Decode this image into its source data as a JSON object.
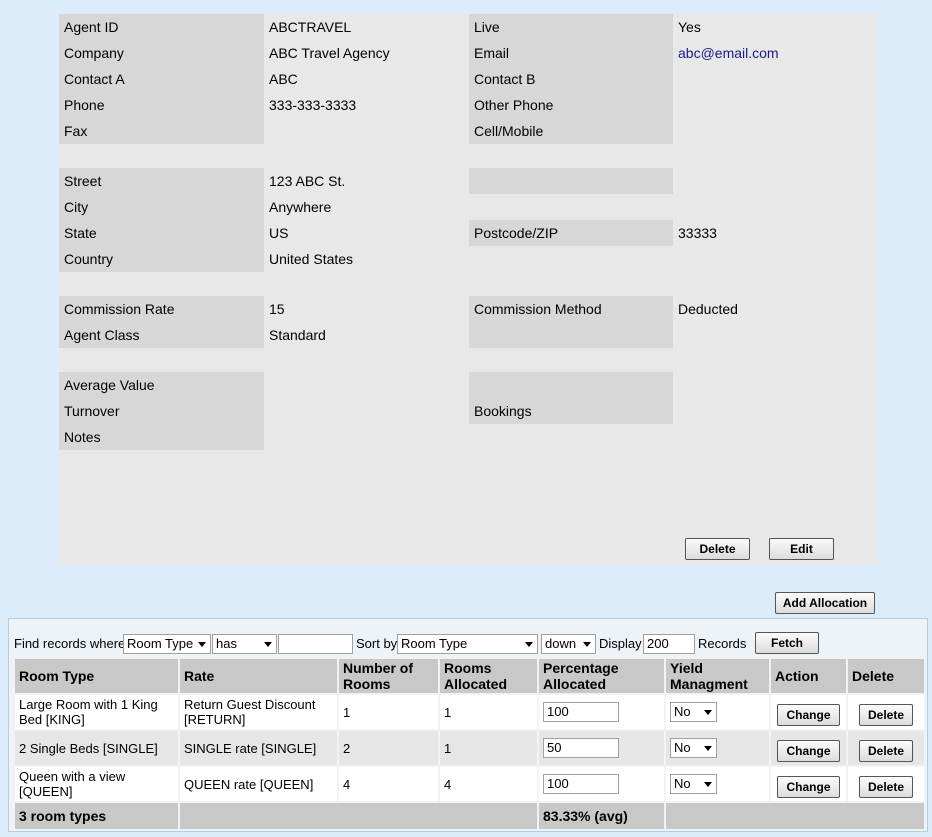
{
  "agent": {
    "fields": {
      "agent_id_label": "Agent ID",
      "agent_id": "ABCTRAVEL",
      "live_label": "Live",
      "live": "Yes",
      "company_label": "Company",
      "company": "ABC Travel Agency",
      "email_label": "Email",
      "email": "abc@email.com",
      "contact_a_label": "Contact A",
      "contact_a": "ABC",
      "contact_b_label": "Contact B",
      "contact_b": "",
      "phone_label": "Phone",
      "phone": "333-333-3333",
      "other_phone_label": "Other Phone",
      "other_phone": "",
      "fax_label": "Fax",
      "fax": "",
      "cell_label": "Cell/Mobile",
      "cell": "",
      "street_label": "Street",
      "street": "123 ABC St.",
      "city_label": "City",
      "city": "Anywhere",
      "state_label": "State",
      "state": "US",
      "postcode_label": "Postcode/ZIP",
      "postcode": "33333",
      "country_label": "Country",
      "country": "United States",
      "commission_rate_label": "Commission Rate",
      "commission_rate": "15",
      "commission_method_label": "Commission Method",
      "commission_method": "Deducted",
      "agent_class_label": "Agent Class",
      "agent_class": "Standard",
      "average_value_label": "Average Value",
      "turnover_label": "Turnover",
      "bookings_label": "Bookings",
      "notes_label": "Notes"
    },
    "buttons": {
      "delete": "Delete",
      "edit": "Edit"
    }
  },
  "allocations": {
    "add_button": "Add Allocation",
    "filter": {
      "find_label": "Find records where",
      "field": "Room Type",
      "operator": "has",
      "value": "",
      "sort_label": "Sort by",
      "sort_field": "Room Type",
      "direction": "down",
      "display_label": "Display",
      "display_count": "200",
      "records_label": "Records",
      "fetch_button": "Fetch"
    },
    "columns": {
      "room_type": "Room Type",
      "rate": "Rate",
      "num_rooms": "Number of Rooms",
      "rooms_allocated": "Rooms Allocated",
      "pct_allocated": "Percentage Allocated",
      "yield": "Yield Managment",
      "action": "Action",
      "delete": "Delete"
    },
    "rows": [
      {
        "room_type": "Large Room with 1 King Bed [KING]",
        "rate": "Return Guest Discount [RETURN]",
        "num_rooms": "1",
        "rooms_allocated": "1",
        "pct": "100",
        "yield": "No",
        "change": "Change",
        "delete": "Delete"
      },
      {
        "room_type": "2 Single Beds [SINGLE]",
        "rate": "SINGLE rate [SINGLE]",
        "num_rooms": "2",
        "rooms_allocated": "1",
        "pct": "50",
        "yield": "No",
        "change": "Change",
        "delete": "Delete"
      },
      {
        "room_type": "Queen with a view [QUEEN]",
        "rate": "QUEEN rate [QUEEN]",
        "num_rooms": "4",
        "rooms_allocated": "4",
        "pct": "100",
        "yield": "No",
        "change": "Change",
        "delete": "Delete"
      }
    ],
    "footer": {
      "count": "3 room types",
      "avg": "83.33% (avg)"
    }
  }
}
